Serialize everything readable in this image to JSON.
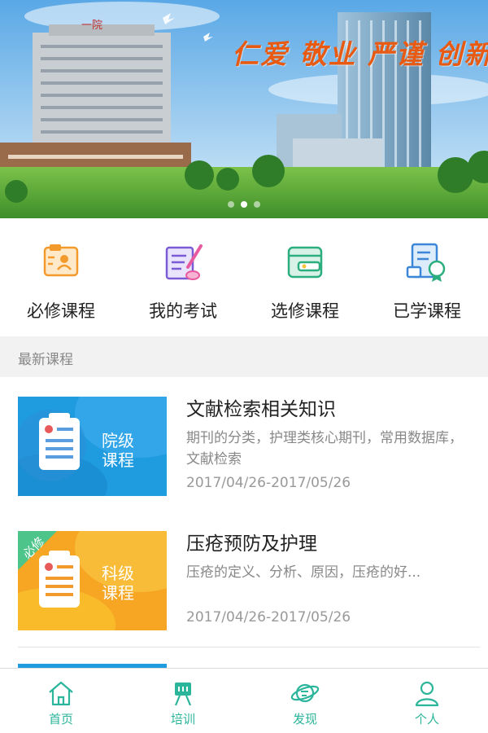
{
  "banner": {
    "slogan": "仁爱 敬业 严谨 创新",
    "building_sign": "一院",
    "slide_count": 3,
    "active_slide": 1
  },
  "menu": {
    "items": [
      {
        "label": "必修课程",
        "icon": "id-card-icon"
      },
      {
        "label": "我的考试",
        "icon": "exam-pen-icon"
      },
      {
        "label": "选修课程",
        "icon": "wallet-icon"
      },
      {
        "label": "已学课程",
        "icon": "certificate-icon"
      }
    ]
  },
  "section": {
    "title": "最新课程"
  },
  "courses": [
    {
      "title": "文献检索相关知识",
      "desc": "期刊的分类，护理类核心期刊，常用数据库，文献检索",
      "date": "2017/04/26-2017/05/26",
      "thumb_label": "院级\n课程",
      "badge": ""
    },
    {
      "title": "压疮预防及护理",
      "desc": "压疮的定义、分析、原因，压疮的好...",
      "date": "2017/04/26-2017/05/26",
      "thumb_label": "科级\n课程",
      "badge": "必修"
    }
  ],
  "tabs": [
    {
      "label": "首页",
      "icon": "home-icon"
    },
    {
      "label": "培训",
      "icon": "training-easel-icon"
    },
    {
      "label": "发现",
      "icon": "planet-icon"
    },
    {
      "label": "个人",
      "icon": "person-icon"
    }
  ],
  "colors": {
    "accent": "#2bb59a",
    "slogan": "#e85a12",
    "thumb_blue": "#1f9be0",
    "thumb_orange": "#f6a623"
  }
}
